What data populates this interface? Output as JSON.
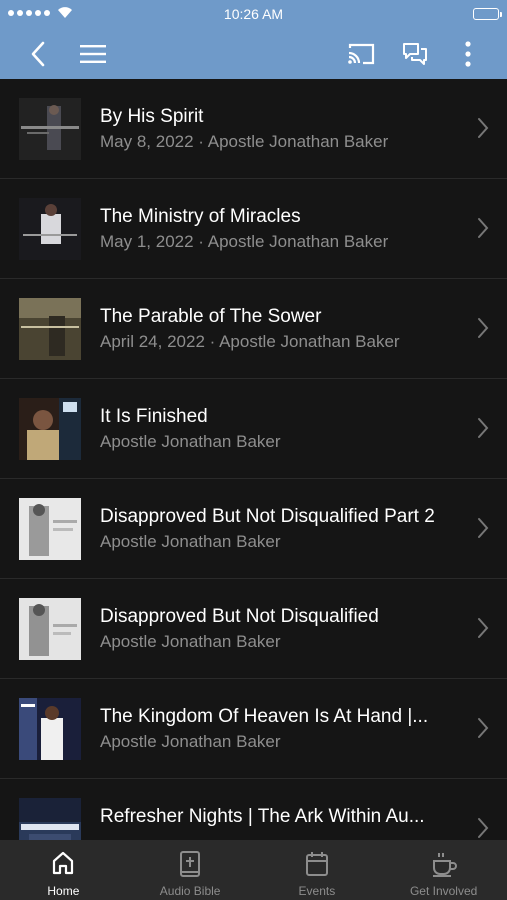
{
  "status_bar": {
    "time": "10:26 AM"
  },
  "nav": {
    "icons": [
      "back-icon",
      "menu-icon",
      "cast-icon",
      "chat-icon",
      "more-icon"
    ]
  },
  "sermons": [
    {
      "title": "By His Spirit",
      "subtitle": "May 8, 2022 · Apostle Jonathan Baker"
    },
    {
      "title": "The Ministry of Miracles",
      "subtitle": "May 1, 2022 · Apostle Jonathan Baker"
    },
    {
      "title": "The Parable of The Sower",
      "subtitle": "April 24, 2022 · Apostle Jonathan Baker"
    },
    {
      "title": "It Is Finished",
      "subtitle": "Apostle Jonathan Baker"
    },
    {
      "title": "Disapproved But Not Disqualified Part 2",
      "subtitle": "Apostle Jonathan Baker"
    },
    {
      "title": "Disapproved But Not Disqualified",
      "subtitle": "Apostle Jonathan Baker"
    },
    {
      "title": "The Kingdom Of Heaven Is At Hand |...",
      "subtitle": "Apostle Jonathan Baker"
    },
    {
      "title": "Refresher Nights | The Ark Within Au...",
      "subtitle": ""
    }
  ],
  "tabs": [
    {
      "label": "Home",
      "icon": "home-icon",
      "active": true
    },
    {
      "label": "Audio Bible",
      "icon": "bible-icon",
      "active": false
    },
    {
      "label": "Events",
      "icon": "calendar-icon",
      "active": false
    },
    {
      "label": "Get Involved",
      "icon": "cup-icon",
      "active": false
    }
  ],
  "colors": {
    "header": "#6f9ac9",
    "background": "#151515",
    "tabbar": "#2a2a2a"
  }
}
